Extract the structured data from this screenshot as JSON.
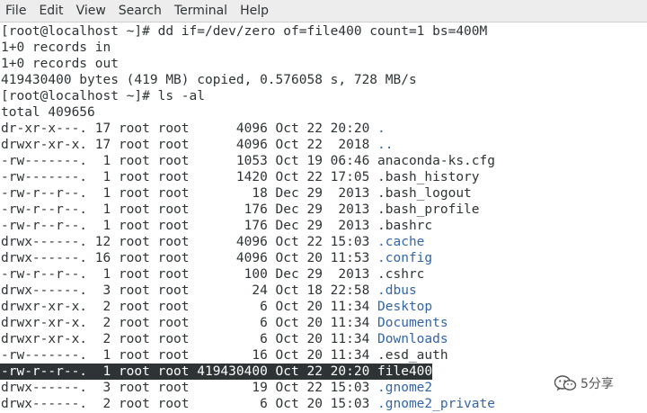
{
  "menu": [
    "File",
    "Edit",
    "View",
    "Search",
    "Terminal",
    "Help"
  ],
  "terminal": {
    "lines": [
      {
        "text": "[root@localhost ~]# dd if=/dev/zero of=file400 count=1 bs=400M"
      },
      {
        "text": "1+0 records in"
      },
      {
        "text": "1+0 records out"
      },
      {
        "text": "419430400 bytes (419 MB) copied, 0.576058 s, 728 MB/s"
      },
      {
        "text": "[root@localhost ~]# ls -al"
      },
      {
        "text": "total 409656"
      },
      {
        "prefix": "dr-xr-x---. 17 root root      4096 Oct 22 20:20 ",
        "name": ".",
        "dir": true
      },
      {
        "prefix": "drwxr-xr-x. 17 root root      4096 Oct 22  2018 ",
        "name": "..",
        "dir": true
      },
      {
        "prefix": "-rw-------.  1 root root      1053 Oct 19 06:46 ",
        "name": "anaconda-ks.cfg",
        "dir": false
      },
      {
        "prefix": "-rw-------.  1 root root      1420 Oct 22 17:05 ",
        "name": ".bash_history",
        "dir": false
      },
      {
        "prefix": "-rw-r--r--.  1 root root        18 Dec 29  2013 ",
        "name": ".bash_logout",
        "dir": false
      },
      {
        "prefix": "-rw-r--r--.  1 root root       176 Dec 29  2013 ",
        "name": ".bash_profile",
        "dir": false
      },
      {
        "prefix": "-rw-r--r--.  1 root root       176 Dec 29  2013 ",
        "name": ".bashrc",
        "dir": false
      },
      {
        "prefix": "drwx------. 12 root root      4096 Oct 22 15:03 ",
        "name": ".cache",
        "dir": true
      },
      {
        "prefix": "drwx------. 16 root root      4096 Oct 20 11:53 ",
        "name": ".config",
        "dir": true
      },
      {
        "prefix": "-rw-r--r--.  1 root root       100 Dec 29  2013 ",
        "name": ".cshrc",
        "dir": false
      },
      {
        "prefix": "drwx------.  3 root root        24 Oct 18 22:58 ",
        "name": ".dbus",
        "dir": true
      },
      {
        "prefix": "drwxr-xr-x.  2 root root         6 Oct 20 11:34 ",
        "name": "Desktop",
        "dir": true
      },
      {
        "prefix": "drwxr-xr-x.  2 root root         6 Oct 20 11:34 ",
        "name": "Documents",
        "dir": true
      },
      {
        "prefix": "drwxr-xr-x.  2 root root         6 Oct 20 11:34 ",
        "name": "Downloads",
        "dir": true
      },
      {
        "prefix": "-rw-------.  1 root root        16 Oct 20 11:34 ",
        "name": ".esd_auth",
        "dir": false
      },
      {
        "prefix": "-rw-r--r--.  1 root root 419430400 Oct 22 20:20 ",
        "name": "file400",
        "dir": false,
        "highlight": true
      },
      {
        "prefix": "drwx------.  3 root root        19 Oct 22 15:03 ",
        "name": ".gnome2",
        "dir": true
      },
      {
        "prefix": "drwx------.  2 root root         6 Oct 20 15:03 ",
        "name": ".gnome2_private",
        "dir": true
      }
    ]
  },
  "watermark": {
    "text": "5分享",
    "icon": "wechat-icon"
  }
}
